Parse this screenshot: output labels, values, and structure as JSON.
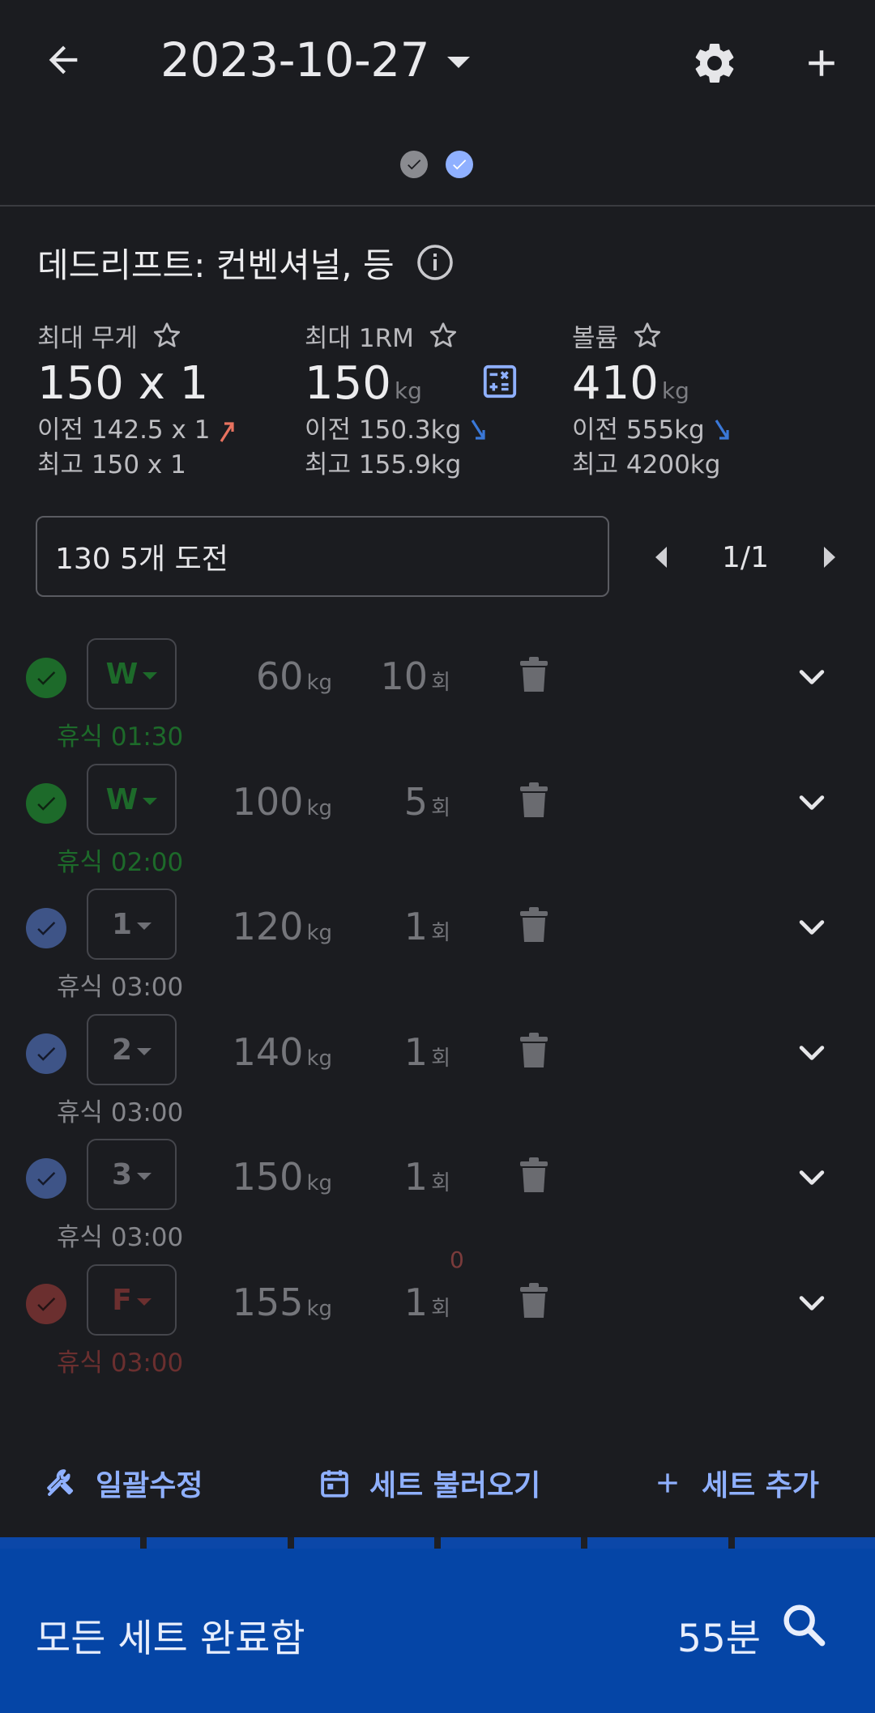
{
  "header": {
    "date": "2023-10-27",
    "icons": [
      "back-arrow-icon",
      "dropdown-caret-icon",
      "gear-icon",
      "plus-icon"
    ]
  },
  "exercise": {
    "name": "데드리프트: 컨벤셔널, 등",
    "stats": {
      "max_weight": {
        "label": "최대 무게",
        "value": "150 x 1",
        "prev": "이전 142.5 x 1",
        "best": "최고 150 x 1",
        "trend": "up"
      },
      "max_1rm": {
        "label": "최대 1RM",
        "value": "150",
        "unit": "kg",
        "prev": "이전 150.3kg",
        "best": "최고 155.9kg",
        "trend": "down"
      },
      "volume": {
        "label": "볼륨",
        "value": "410",
        "unit": "kg",
        "prev": "이전 555kg",
        "best": "최고 4200kg",
        "trend": "down"
      }
    },
    "note": "130 5개 도전",
    "pager": "1/1"
  },
  "sets": [
    {
      "type": "W",
      "weight": "60",
      "reps": "10",
      "rest": "휴식 01:30",
      "status": "done-warmup"
    },
    {
      "type": "W",
      "weight": "100",
      "reps": "5",
      "rest": "휴식 02:00",
      "status": "done-warmup"
    },
    {
      "type": "1",
      "weight": "120",
      "reps": "1",
      "rest": "휴식 03:00",
      "status": "done"
    },
    {
      "type": "2",
      "weight": "140",
      "reps": "1",
      "rest": "휴식 03:00",
      "status": "done"
    },
    {
      "type": "3",
      "weight": "150",
      "reps": "1",
      "rest": "휴식 03:00",
      "status": "done"
    },
    {
      "type": "F",
      "weight": "155",
      "reps": "1",
      "rest": "휴식 03:00",
      "status": "failed",
      "rpe": "0"
    }
  ],
  "units": {
    "weight": "kg",
    "reps": "회"
  },
  "actions": {
    "bulk_edit": "일괄수정",
    "load_sets": "세트 불러오기",
    "add_set": "세트 추가"
  },
  "footer": {
    "status": "모든 세트 완료함",
    "duration": "55분"
  },
  "colors": {
    "background": "#1b1c20",
    "accent": "#8fb0ff",
    "footer": "#0545a6",
    "warmup_green": "#1d6a2a",
    "done_blue": "#3e5487",
    "failed_red": "#6b2f2f",
    "trend_up": "#e8725f",
    "trend_down": "#3a78d8"
  }
}
